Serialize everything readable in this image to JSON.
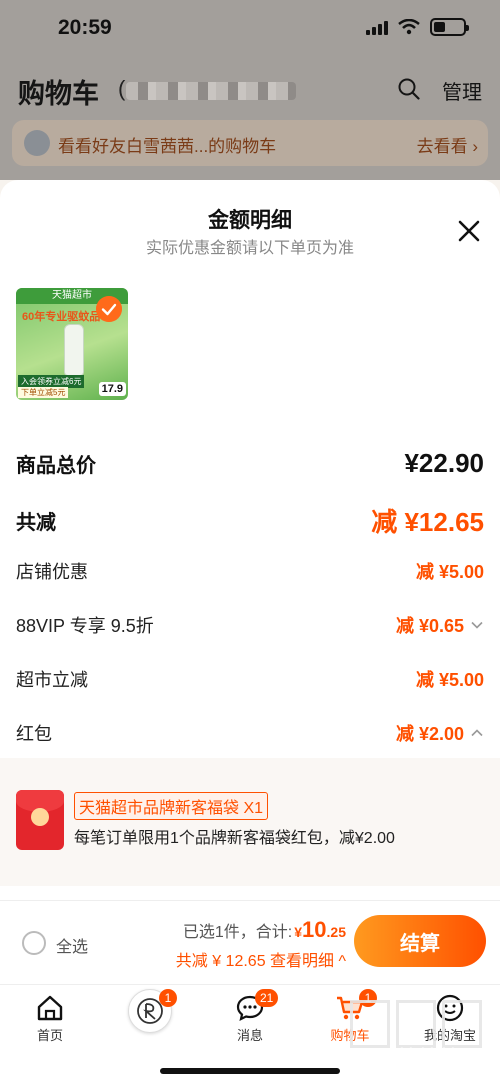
{
  "status_bar": {
    "time": "20:59"
  },
  "cart_header": {
    "title": "购物车",
    "count_prefix": "(",
    "friend_prompt": "看看好友白雪茜茜...的购物车",
    "friend_link": "去看看 ›",
    "manage_label": "管理",
    "search_icon": "search-icon"
  },
  "sheet": {
    "title": "金额明细",
    "subtitle": "实际优惠金额请以下单页为准",
    "close_icon": "close-icon",
    "product_thumb": {
      "brand_banner": "天猫超市",
      "headline": "60年专业驱蚊品",
      "promo1": "入会领券立减6元",
      "promo2": "下单立减5元",
      "price": "17.9"
    },
    "rows": {
      "total_label": "商品总价",
      "total_value": "¥22.90",
      "reduce_label": "共减",
      "reduce_value": "减 ¥12.65",
      "store_label": "店铺优惠",
      "store_value": "减 ¥5.00",
      "vip_label": "88VIP 专享 9.5折",
      "vip_value": "减 ¥0.65",
      "market_label": "超市立减",
      "market_value": "减 ¥5.00",
      "hongbao_label": "红包",
      "hongbao_value": "减 ¥2.00"
    },
    "hongbao": {
      "tag": "天猫超市品牌新客福袋 X1",
      "desc": "每笔订单限用1个品牌新客福袋红包，减¥2.00"
    }
  },
  "checkout": {
    "select_all": "全选",
    "summary_prefix": "已选1件，合计:",
    "summary_currency": "¥",
    "summary_int": "10",
    "summary_dec": ".25",
    "detail": "共减 ¥ 12.65  查看明细 ^",
    "checkout_label": "结算"
  },
  "tab_bar": {
    "tabs": [
      {
        "label": "首页",
        "icon": "home-icon"
      },
      {
        "label": "",
        "icon": "avatar-icon",
        "badge": "1"
      },
      {
        "label": "消息",
        "icon": "message-icon",
        "badge": "21"
      },
      {
        "label": "购物车",
        "icon": "cart-icon",
        "badge": "1"
      },
      {
        "label": "我的淘宝",
        "icon": "profile-icon"
      }
    ]
  },
  "watermark": "zhizhizhi.com",
  "colors": {
    "accent": "#ff5000",
    "dim_overlay": "#a39f9b"
  }
}
